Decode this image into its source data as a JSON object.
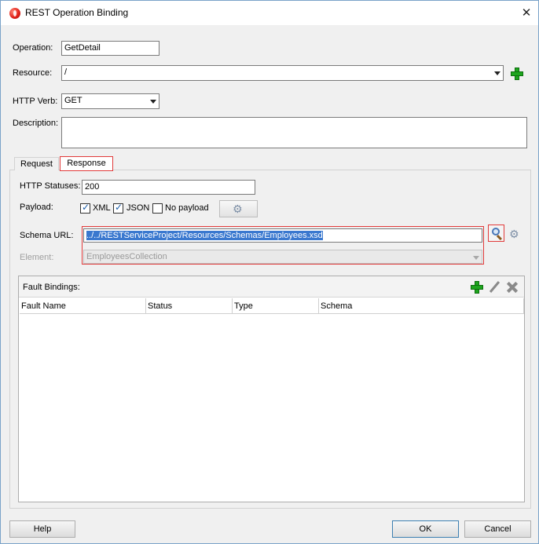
{
  "window": {
    "title": "REST Operation Binding",
    "close_label": "✕"
  },
  "form": {
    "operation_label": "Operation:",
    "operation_value": "GetDetail",
    "resource_label": "Resource:",
    "resource_value": "/",
    "http_verb_label": "HTTP Verb:",
    "http_verb_value": "GET",
    "description_label": "Description:",
    "description_value": ""
  },
  "tabs": [
    {
      "label": "Request",
      "active": false
    },
    {
      "label": "Response",
      "active": true
    }
  ],
  "response": {
    "http_statuses_label": "HTTP Statuses:",
    "http_statuses_value": "200",
    "payload_label": "Payload:",
    "payload_options": [
      {
        "label": "XML",
        "checked": true
      },
      {
        "label": "JSON",
        "checked": true
      },
      {
        "label": "No payload",
        "checked": false
      }
    ],
    "schema_url_label": "Schema URL:",
    "schema_url_value": "../../RESTServiceProject/Resources/Schemas/Employees.xsd",
    "element_label": "Element:",
    "element_value": "EmployeesCollection"
  },
  "fault_bindings": {
    "label": "Fault Bindings:",
    "columns": [
      "Fault Name",
      "Status",
      "Type",
      "Schema"
    ],
    "rows": []
  },
  "buttons": {
    "help": "Help",
    "ok": "OK",
    "cancel": "Cancel"
  },
  "colors": {
    "highlight_border": "#e13a3a",
    "selection": "#3a78cf",
    "add_green": "#1ea51e"
  },
  "icons": [
    "app-icon",
    "close-icon",
    "add-icon",
    "gear-icon",
    "search-icon",
    "edit-icon",
    "delete-icon"
  ]
}
